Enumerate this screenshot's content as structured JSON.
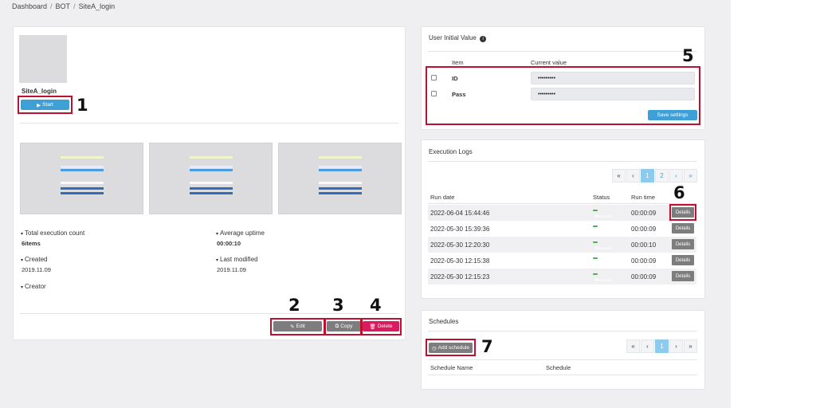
{
  "breadcrumb": {
    "items": [
      "Dashboard",
      "BOT",
      "SiteA_login"
    ]
  },
  "bot": {
    "name": "SiteA_login",
    "start_label": "Start",
    "stats": {
      "total_execution_label": "Total execution count",
      "total_execution_value": "6items",
      "average_uptime_label": "Average uptime",
      "average_uptime_value": "00:00:10",
      "created_label": "Created",
      "created_value": "2019.11.09",
      "last_modified_label": "Last modified",
      "last_modified_value": "2019.11.09",
      "creator_label": "Creator"
    },
    "actions": {
      "edit_label": "Edit",
      "copy_label": "Copy",
      "delete_label": "Delete"
    }
  },
  "initial_value": {
    "title": "User Initial Value",
    "col_item": "Item",
    "col_value": "Current value",
    "rows": [
      {
        "item": "ID",
        "value": "•••••••••"
      },
      {
        "item": "Pass",
        "value": "•••••••••"
      }
    ],
    "save_label": "Save settings"
  },
  "logs": {
    "title": "Execution Logs",
    "pager": [
      "«",
      "‹",
      "1",
      "2",
      "›",
      "»"
    ],
    "col_date": "Run date",
    "col_status": "Status",
    "col_time": "Run time",
    "rows": [
      {
        "date": "2022-06-04 15:44:46",
        "status": "Success",
        "time": "00:00:09",
        "details": "Details"
      },
      {
        "date": "2022-05-30 15:39:36",
        "status": "Success",
        "time": "00:00:09",
        "details": "Details"
      },
      {
        "date": "2022-05-30 12:20:30",
        "status": "Success",
        "time": "00:00:10",
        "details": "Details"
      },
      {
        "date": "2022-05-30 12:15:38",
        "status": "Success",
        "time": "00:00:09",
        "details": "Details"
      },
      {
        "date": "2022-05-30 12:15:23",
        "status": "Success",
        "time": "00:00:09",
        "details": "Details"
      }
    ]
  },
  "schedules": {
    "title": "Schedules",
    "add_label": "Add schedule",
    "pager": [
      "«",
      "‹",
      "1",
      "›",
      "»"
    ],
    "col_name": "Schedule Name",
    "col_schedule": "Schedule"
  },
  "annotations": [
    "1",
    "2",
    "3",
    "4",
    "5",
    "6",
    "7"
  ],
  "colors": {
    "accent_blue": "#3fa0d8",
    "delete_pink": "#dc1a5e",
    "success_green": "#4caf50",
    "highlight_red": "#c01030"
  }
}
